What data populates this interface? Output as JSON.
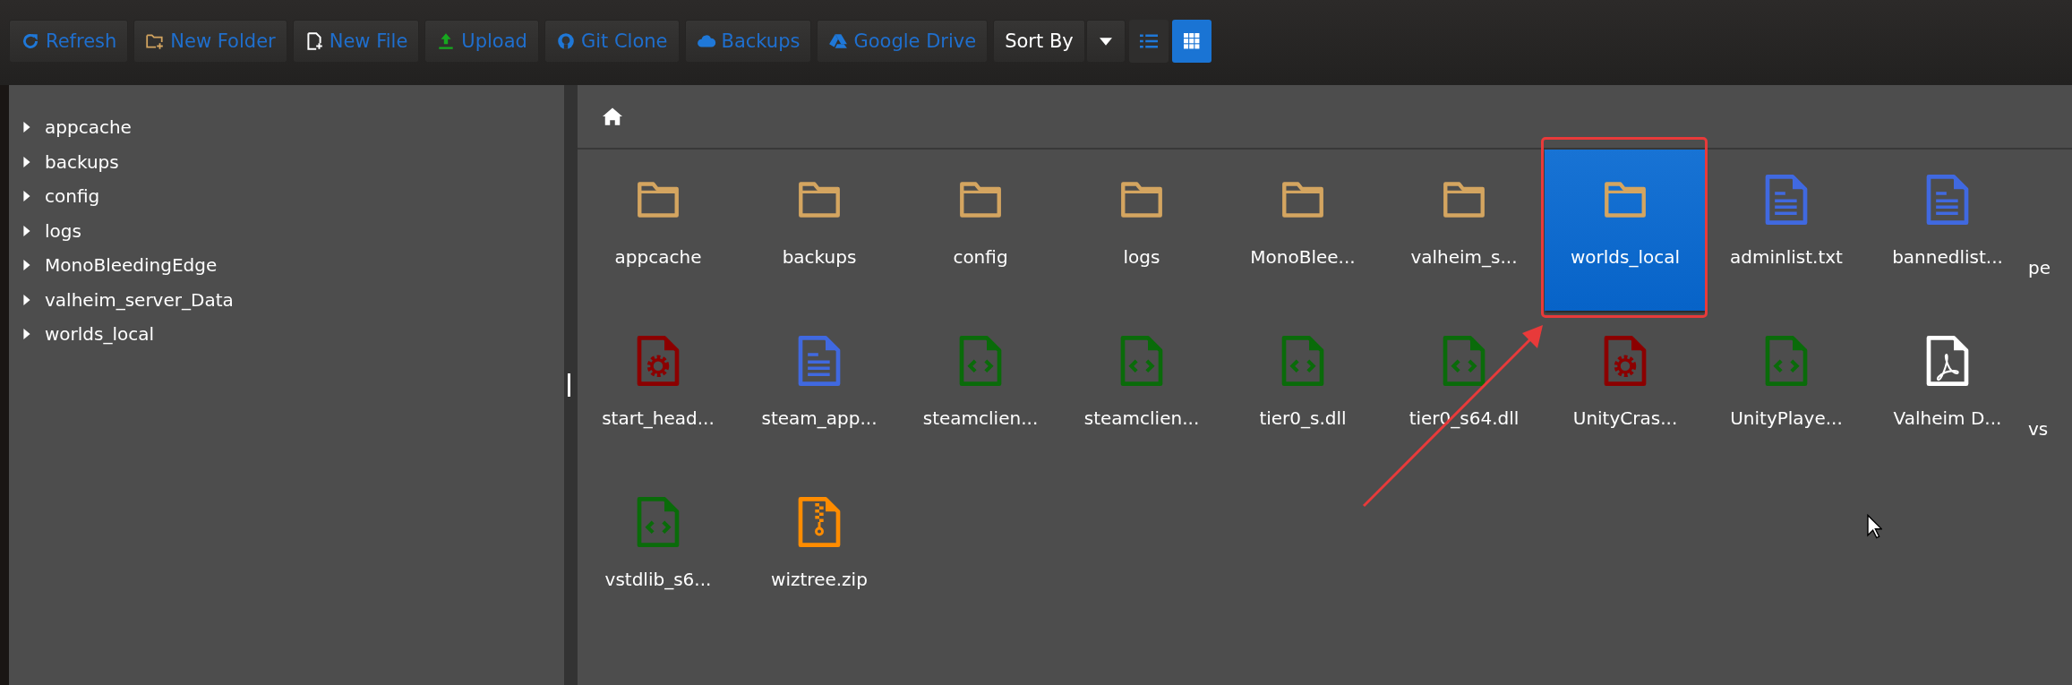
{
  "toolbar": {
    "buttons": [
      {
        "kind": "refresh",
        "label": "Refresh"
      },
      {
        "kind": "new-folder",
        "label": "New Folder"
      },
      {
        "kind": "new-file",
        "label": "New File"
      },
      {
        "kind": "upload",
        "label": "Upload"
      },
      {
        "kind": "git",
        "label": "Git Clone"
      },
      {
        "kind": "cloud",
        "label": "Backups"
      },
      {
        "kind": "drive",
        "label": "Google Drive"
      }
    ],
    "sort": {
      "label": "Sort By"
    },
    "views": [
      {
        "kind": "list",
        "selected": false
      },
      {
        "kind": "grid",
        "selected": true
      }
    ]
  },
  "sidebar": {
    "items": [
      {
        "label": "appcache",
        "expanded": false
      },
      {
        "label": "backups",
        "expanded": false
      },
      {
        "label": "config",
        "expanded": false
      },
      {
        "label": "logs",
        "expanded": false
      },
      {
        "label": "MonoBleedingEdge",
        "expanded": false
      },
      {
        "label": "valheim_server_Data",
        "expanded": false
      },
      {
        "label": "worlds_local",
        "expanded": false
      }
    ]
  },
  "files": [
    {
      "kind": "folder",
      "name": "appcache",
      "selected": false
    },
    {
      "kind": "folder",
      "name": "backups",
      "selected": false
    },
    {
      "kind": "folder",
      "name": "config",
      "selected": false
    },
    {
      "kind": "folder",
      "name": "logs",
      "selected": false
    },
    {
      "kind": "folder",
      "name": "MonoBlee...",
      "selected": false
    },
    {
      "kind": "folder",
      "name": "valheim_s...",
      "selected": false
    },
    {
      "kind": "folder",
      "name": "worlds_local",
      "selected": true
    },
    {
      "kind": "text",
      "name": "adminlist.txt",
      "selected": false
    },
    {
      "kind": "text",
      "name": "bannedlist...",
      "selected": false
    },
    {
      "kind": "clipped",
      "name": "pe"
    },
    {
      "kind": "config",
      "name": "start_head...",
      "selected": false
    },
    {
      "kind": "text",
      "name": "steam_app...",
      "selected": false
    },
    {
      "kind": "code",
      "name": "steamclien...",
      "selected": false
    },
    {
      "kind": "code",
      "name": "steamclien...",
      "selected": false
    },
    {
      "kind": "code",
      "name": "tier0_s.dll",
      "selected": false
    },
    {
      "kind": "code",
      "name": "tier0_s64.dll",
      "selected": false
    },
    {
      "kind": "config",
      "name": "UnityCras...",
      "selected": false
    },
    {
      "kind": "code",
      "name": "UnityPlaye...",
      "selected": false
    },
    {
      "kind": "pdf",
      "name": "Valheim D...",
      "selected": false
    },
    {
      "kind": "clipped",
      "name": "vs"
    },
    {
      "kind": "code",
      "name": "vstdlib_s6...",
      "selected": false
    },
    {
      "kind": "zip",
      "name": "wiztree.zip",
      "selected": false
    }
  ]
}
